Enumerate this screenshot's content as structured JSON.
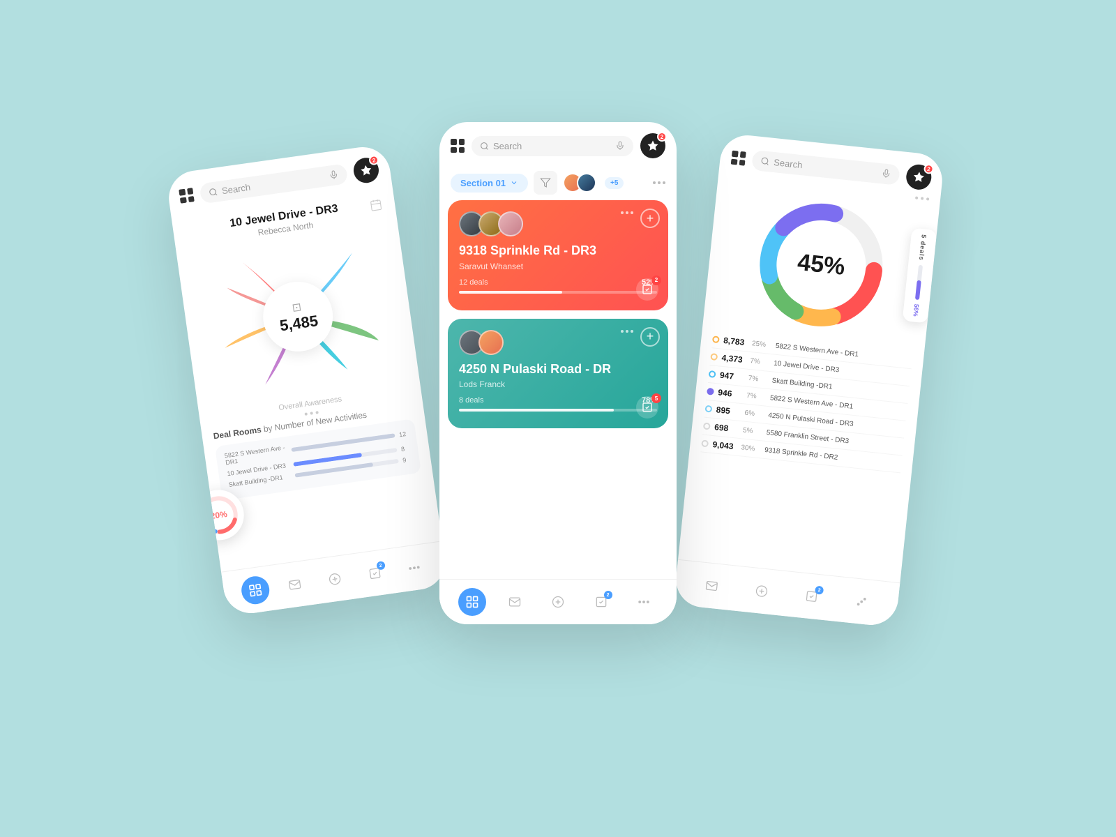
{
  "app": {
    "name": "N",
    "notification_count": "2"
  },
  "search": {
    "placeholder": "Search"
  },
  "left_phone": {
    "property": "10 Jewel Drive - DR3",
    "person": "Rebecca North",
    "center_value": "5,485",
    "overall_label": "Overall Awareness",
    "donut_pct": "20%",
    "deal_rooms_title": "Deal Rooms",
    "deal_rooms_subtitle": "by Number of New Activities",
    "bars": [
      {
        "label": "5822 S Western Ave - DR1",
        "value": 12,
        "max": 12,
        "pct": 100
      },
      {
        "label": "10 Jewel Drive - DR3",
        "value": 8,
        "max": 12,
        "pct": 66
      },
      {
        "label": "Skatt Building -DR1",
        "value": 9,
        "max": 12,
        "pct": 75
      }
    ],
    "nav": [
      "chart",
      "message",
      "plus",
      "task",
      "dots"
    ]
  },
  "center_phone": {
    "section": "Section 01",
    "more_count": "+5",
    "card1": {
      "title": "9318 Sprinkle Rd - DR3",
      "subtitle": "Saravut Whanset",
      "deals": "12 deals",
      "pct": "52%",
      "progress": 52,
      "task_num": "2"
    },
    "card2": {
      "title": "4250 N Pulaski Road - DR",
      "subtitle": "Lods Franck",
      "deals": "8 deals",
      "pct": "78%",
      "progress": 78,
      "task_num": "5"
    },
    "nav": [
      "chart",
      "message",
      "plus",
      "task",
      "dots"
    ]
  },
  "right_phone": {
    "donut_pct": "45%",
    "five_deals": "5 deals",
    "progress_pct": "56%",
    "data_rows": [
      {
        "value": "8,783",
        "pct": "25%",
        "name": "5822 S Western Ave - DR1",
        "dot": "orange"
      },
      {
        "value": "4,373",
        "pct": "7%",
        "name": "10 Jewel Drive - DR3",
        "dot": "orange-light"
      },
      {
        "value": "947",
        "pct": "7%",
        "name": "Skatt Building -DR1",
        "dot": "blue"
      },
      {
        "value": "946",
        "pct": "7%",
        "name": "5822 S Western Ave - DR1",
        "dot": "purple-filled"
      },
      {
        "value": "895",
        "pct": "6%",
        "name": "4250 N Pulaski Road - DR3",
        "dot": "blue-light"
      },
      {
        "value": "698",
        "pct": "5%",
        "name": "5580 Franklin Street - DR3",
        "dot": "empty"
      },
      {
        "value": "9,043",
        "pct": "30%",
        "name": "9318 Sprinkle Rd - DR2",
        "dot": "empty"
      }
    ],
    "nav": [
      "message",
      "plus",
      "task",
      "dots"
    ]
  }
}
